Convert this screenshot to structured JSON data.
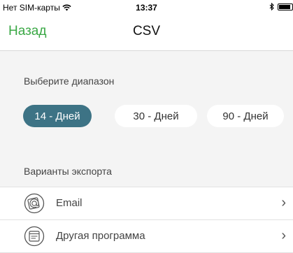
{
  "status": {
    "carrier": "Нет SIM-карты",
    "time": "13:37"
  },
  "nav": {
    "back_label": "Назад",
    "title": "CSV"
  },
  "range": {
    "label": "Выберите диапазон",
    "options": [
      "14 - Дней",
      "30 - Дней",
      "90 - Дней"
    ],
    "selected": "14 - Дней"
  },
  "export": {
    "label": "Варианты экспорта",
    "items": [
      {
        "label": "Email",
        "icon": "email-icon"
      },
      {
        "label": "Другая программа",
        "icon": "app-icon"
      }
    ]
  },
  "colors": {
    "accent": "#3aa845",
    "selected_pill": "#3d7385",
    "background": "#f4f4f4"
  }
}
